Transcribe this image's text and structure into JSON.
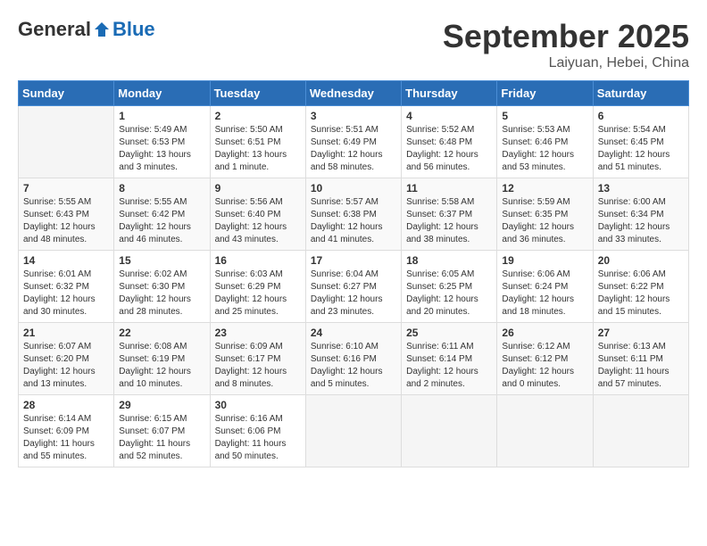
{
  "logo": {
    "general": "General",
    "blue": "Blue"
  },
  "header": {
    "month": "September 2025",
    "location": "Laiyuan, Hebei, China"
  },
  "days_of_week": [
    "Sunday",
    "Monday",
    "Tuesday",
    "Wednesday",
    "Thursday",
    "Friday",
    "Saturday"
  ],
  "weeks": [
    [
      {
        "day": "",
        "info": ""
      },
      {
        "day": "1",
        "info": "Sunrise: 5:49 AM\nSunset: 6:53 PM\nDaylight: 13 hours\nand 3 minutes."
      },
      {
        "day": "2",
        "info": "Sunrise: 5:50 AM\nSunset: 6:51 PM\nDaylight: 13 hours\nand 1 minute."
      },
      {
        "day": "3",
        "info": "Sunrise: 5:51 AM\nSunset: 6:49 PM\nDaylight: 12 hours\nand 58 minutes."
      },
      {
        "day": "4",
        "info": "Sunrise: 5:52 AM\nSunset: 6:48 PM\nDaylight: 12 hours\nand 56 minutes."
      },
      {
        "day": "5",
        "info": "Sunrise: 5:53 AM\nSunset: 6:46 PM\nDaylight: 12 hours\nand 53 minutes."
      },
      {
        "day": "6",
        "info": "Sunrise: 5:54 AM\nSunset: 6:45 PM\nDaylight: 12 hours\nand 51 minutes."
      }
    ],
    [
      {
        "day": "7",
        "info": "Sunrise: 5:55 AM\nSunset: 6:43 PM\nDaylight: 12 hours\nand 48 minutes."
      },
      {
        "day": "8",
        "info": "Sunrise: 5:55 AM\nSunset: 6:42 PM\nDaylight: 12 hours\nand 46 minutes."
      },
      {
        "day": "9",
        "info": "Sunrise: 5:56 AM\nSunset: 6:40 PM\nDaylight: 12 hours\nand 43 minutes."
      },
      {
        "day": "10",
        "info": "Sunrise: 5:57 AM\nSunset: 6:38 PM\nDaylight: 12 hours\nand 41 minutes."
      },
      {
        "day": "11",
        "info": "Sunrise: 5:58 AM\nSunset: 6:37 PM\nDaylight: 12 hours\nand 38 minutes."
      },
      {
        "day": "12",
        "info": "Sunrise: 5:59 AM\nSunset: 6:35 PM\nDaylight: 12 hours\nand 36 minutes."
      },
      {
        "day": "13",
        "info": "Sunrise: 6:00 AM\nSunset: 6:34 PM\nDaylight: 12 hours\nand 33 minutes."
      }
    ],
    [
      {
        "day": "14",
        "info": "Sunrise: 6:01 AM\nSunset: 6:32 PM\nDaylight: 12 hours\nand 30 minutes."
      },
      {
        "day": "15",
        "info": "Sunrise: 6:02 AM\nSunset: 6:30 PM\nDaylight: 12 hours\nand 28 minutes."
      },
      {
        "day": "16",
        "info": "Sunrise: 6:03 AM\nSunset: 6:29 PM\nDaylight: 12 hours\nand 25 minutes."
      },
      {
        "day": "17",
        "info": "Sunrise: 6:04 AM\nSunset: 6:27 PM\nDaylight: 12 hours\nand 23 minutes."
      },
      {
        "day": "18",
        "info": "Sunrise: 6:05 AM\nSunset: 6:25 PM\nDaylight: 12 hours\nand 20 minutes."
      },
      {
        "day": "19",
        "info": "Sunrise: 6:06 AM\nSunset: 6:24 PM\nDaylight: 12 hours\nand 18 minutes."
      },
      {
        "day": "20",
        "info": "Sunrise: 6:06 AM\nSunset: 6:22 PM\nDaylight: 12 hours\nand 15 minutes."
      }
    ],
    [
      {
        "day": "21",
        "info": "Sunrise: 6:07 AM\nSunset: 6:20 PM\nDaylight: 12 hours\nand 13 minutes."
      },
      {
        "day": "22",
        "info": "Sunrise: 6:08 AM\nSunset: 6:19 PM\nDaylight: 12 hours\nand 10 minutes."
      },
      {
        "day": "23",
        "info": "Sunrise: 6:09 AM\nSunset: 6:17 PM\nDaylight: 12 hours\nand 8 minutes."
      },
      {
        "day": "24",
        "info": "Sunrise: 6:10 AM\nSunset: 6:16 PM\nDaylight: 12 hours\nand 5 minutes."
      },
      {
        "day": "25",
        "info": "Sunrise: 6:11 AM\nSunset: 6:14 PM\nDaylight: 12 hours\nand 2 minutes."
      },
      {
        "day": "26",
        "info": "Sunrise: 6:12 AM\nSunset: 6:12 PM\nDaylight: 12 hours\nand 0 minutes."
      },
      {
        "day": "27",
        "info": "Sunrise: 6:13 AM\nSunset: 6:11 PM\nDaylight: 11 hours\nand 57 minutes."
      }
    ],
    [
      {
        "day": "28",
        "info": "Sunrise: 6:14 AM\nSunset: 6:09 PM\nDaylight: 11 hours\nand 55 minutes."
      },
      {
        "day": "29",
        "info": "Sunrise: 6:15 AM\nSunset: 6:07 PM\nDaylight: 11 hours\nand 52 minutes."
      },
      {
        "day": "30",
        "info": "Sunrise: 6:16 AM\nSunset: 6:06 PM\nDaylight: 11 hours\nand 50 minutes."
      },
      {
        "day": "",
        "info": ""
      },
      {
        "day": "",
        "info": ""
      },
      {
        "day": "",
        "info": ""
      },
      {
        "day": "",
        "info": ""
      }
    ]
  ]
}
